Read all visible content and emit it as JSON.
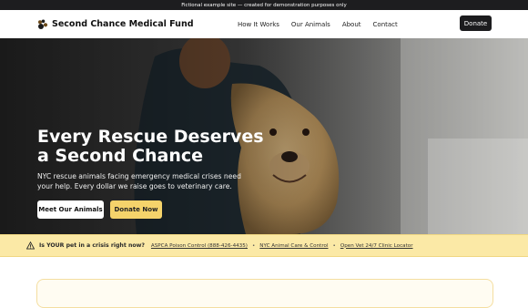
{
  "banner": {
    "text": "Fictional example site — created for demonstration purposes only"
  },
  "nav": {
    "brand": "Second Chance Medical Fund",
    "brand_icon": "paw-icon",
    "links": [
      "How It Works",
      "Our Animals",
      "About",
      "Contact"
    ],
    "donate": "Donate"
  },
  "hero": {
    "title": "Every Rescue Deserves a Second Chance",
    "subtitle": "NYC rescue animals facing emergency medical crises need your help. Every dollar we raise goes to veterinary care.",
    "primary_cta": "Meet Our Animals",
    "secondary_cta": "Donate Now"
  },
  "crisis": {
    "icon": "warning-icon",
    "question": "Is YOUR pet in a crisis right now?",
    "links": [
      "ASPCA Poison Control (888-426-4435)",
      "NYC Animal Care & Control",
      "Open Vet 24/7 Clinic Locator"
    ],
    "separator": "•"
  },
  "colors": {
    "accent": "#f5d36b",
    "dark": "#1c1c1e",
    "crisis_bg": "#fbe9a6"
  }
}
